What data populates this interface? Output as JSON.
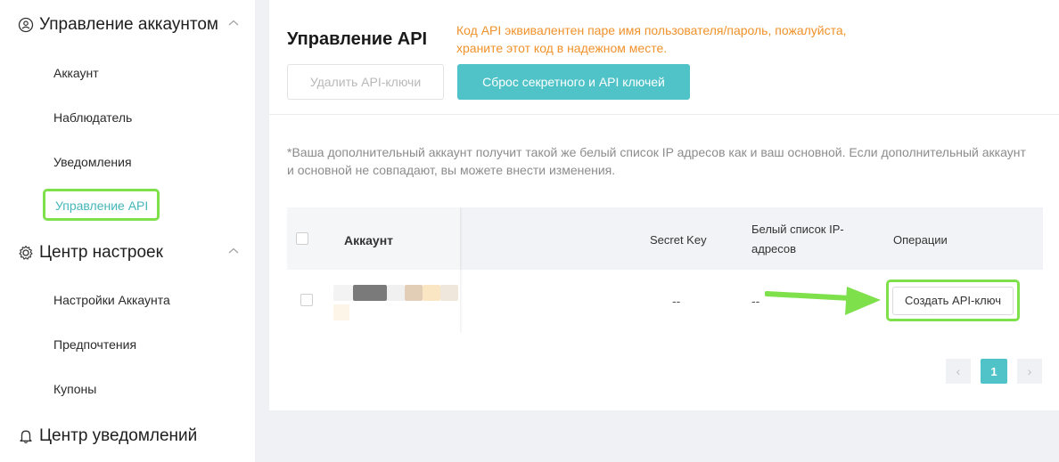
{
  "sidebar": {
    "groups": [
      {
        "title": "Управление аккаунтом",
        "icon": "user-circle-icon",
        "items": [
          {
            "label": "Аккаунт"
          },
          {
            "label": "Наблюдатель"
          },
          {
            "label": "Уведомления"
          },
          {
            "label": "Управление API",
            "active": true
          }
        ]
      },
      {
        "title": "Центр настроек",
        "icon": "gear-icon",
        "items": [
          {
            "label": "Настройки Аккаунта"
          },
          {
            "label": "Предпочтения"
          },
          {
            "label": "Купоны"
          }
        ]
      },
      {
        "title": "Центр уведомлений",
        "icon": "bell-icon",
        "items": []
      }
    ]
  },
  "main": {
    "title": "Управление API",
    "warning": "Код API эквивалентен паре имя пользователя/пароль, пожалуйста, храните этот код в надежном месте.",
    "delete_button": "Удалить API-ключи",
    "reset_button": "Сброс секретного и API ключей",
    "note": "*Ваша дополнительный аккаунт получит такой же белый список IP адресов как и ваш основной. Если дополнительный аккаунт и основной не совпадают, вы можете внести изменения.",
    "table": {
      "columns": {
        "account": "Аккаунт",
        "secret_key": "Secret Key",
        "whitelist": "Белый список IP-адресов",
        "operations": "Операции"
      },
      "rows": [
        {
          "secret_key": "--",
          "whitelist": "--",
          "action": "Создать API-ключ"
        }
      ]
    },
    "pagination": {
      "current": "1",
      "prev_icon": "‹",
      "next_icon": "›"
    }
  },
  "colors": {
    "accent": "#4fc3c7",
    "warning": "#f0922b",
    "highlight": "#7ee04a"
  }
}
